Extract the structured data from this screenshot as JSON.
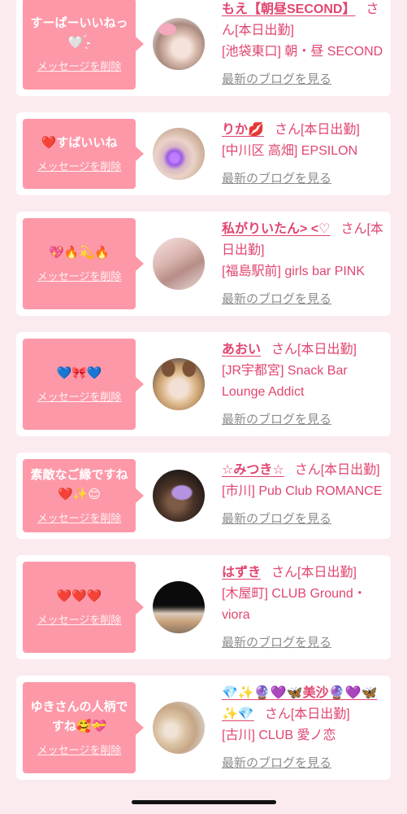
{
  "theme": {
    "background": "#fbeaee",
    "card": "#ffffff",
    "accent": "#e0466f",
    "bubble": "#fd98a8",
    "muted": "#8c8c8c"
  },
  "messages": [
    {
      "message": "すーぱーいいねっ🤍 ̖́-",
      "delete_label": "メッセージを削除",
      "name": "もえ【朝昼SECOND】",
      "status": "さん[本日出勤]",
      "shop": "[池袋東口] 朝・昼 SECOND",
      "blog_link": "最新のブログを見る"
    },
    {
      "message": "❤️すばいいね",
      "delete_label": "メッセージを削除",
      "name": "りか💋",
      "status": "さん[本日出勤]",
      "shop": "[中川区 高畑] EPSILON",
      "blog_link": "最新のブログを見る"
    },
    {
      "message": "💖🔥💫🔥",
      "delete_label": "メッセージを削除",
      "name": "私がりいたん> <♡",
      "status": "さん[本日出勤]",
      "shop": "[福島駅前] girls bar PINK",
      "blog_link": "最新のブログを見る"
    },
    {
      "message": "💙🎀💙",
      "delete_label": "メッセージを削除",
      "name": "あおい",
      "status": "さん[本日出勤]",
      "shop": "[JR宇都宮] Snack Bar Lounge Addict",
      "blog_link": "最新のブログを見る"
    },
    {
      "message": "素敵なご縁ですね❤️✨😊",
      "delete_label": "メッセージを削除",
      "name": "☆みつき☆",
      "status": "さん[本日出勤]",
      "shop": "[市川] Pub Club ROMANCE",
      "blog_link": "最新のブログを見る"
    },
    {
      "message": "❤️❤️❤️",
      "delete_label": "メッセージを削除",
      "name": "はずき",
      "status": "さん[本日出勤]",
      "shop": "[木屋町] CLUB Ground・viora",
      "blog_link": "最新のブログを見る"
    },
    {
      "message": "ゆきさんの人柄ですね🥰💝",
      "delete_label": "メッセージを削除",
      "name": "💎✨🔮💜🦋美沙🔮💜🦋✨💎",
      "status": "さん[本日出勤]",
      "shop": "[古川] CLUB 愛ノ恋",
      "blog_link": "最新のブログを見る"
    }
  ]
}
